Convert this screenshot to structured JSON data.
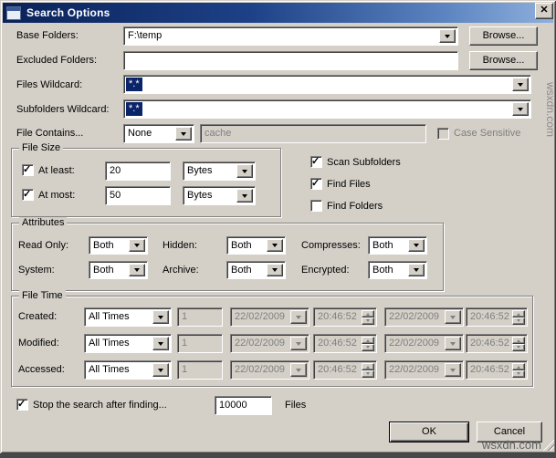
{
  "window": {
    "title": "Search Options",
    "close_glyph": "✕"
  },
  "rows": {
    "base_folders": {
      "label": "Base Folders:",
      "value": "F:\\temp",
      "browse": "Browse..."
    },
    "excluded_folders": {
      "label": "Excluded Folders:",
      "value": "",
      "browse": "Browse..."
    },
    "files_wildcard": {
      "label": "Files Wildcard:",
      "value": "*.*"
    },
    "subfolders_wildcard": {
      "label": "Subfolders Wildcard:",
      "value": "*.*"
    },
    "file_contains": {
      "label": "File Contains...",
      "mode": "None",
      "text": "cache",
      "case_label": "Case Sensitive",
      "case_checked": false,
      "case_enabled": false
    }
  },
  "file_size": {
    "title": "File Size",
    "rows": [
      {
        "label": "At least:",
        "checked": true,
        "value": "20",
        "unit": "Bytes"
      },
      {
        "label": "At most:",
        "checked": true,
        "value": "50",
        "unit": "Bytes"
      }
    ]
  },
  "options": [
    {
      "label": "Scan Subfolders",
      "checked": true
    },
    {
      "label": "Find Files",
      "checked": true
    },
    {
      "label": "Find Folders",
      "checked": false
    }
  ],
  "attributes": {
    "title": "Attributes",
    "items": [
      {
        "label": "Read Only:",
        "value": "Both"
      },
      {
        "label": "Hidden:",
        "value": "Both"
      },
      {
        "label": "Compresses:",
        "value": "Both"
      },
      {
        "label": "System:",
        "value": "Both"
      },
      {
        "label": "Archive:",
        "value": "Both"
      },
      {
        "label": "Encrypted:",
        "value": "Both"
      }
    ]
  },
  "file_time": {
    "title": "File Time",
    "rows": [
      {
        "label": "Created:",
        "mode": "All Times",
        "count": "1",
        "date1": "22/02/2009",
        "time1": "20:46:52",
        "date2": "22/02/2009",
        "time2": "20:46:52"
      },
      {
        "label": "Modified:",
        "mode": "All Times",
        "count": "1",
        "date1": "22/02/2009",
        "time1": "20:46:52",
        "date2": "22/02/2009",
        "time2": "20:46:52"
      },
      {
        "label": "Accessed:",
        "mode": "All Times",
        "count": "1",
        "date1": "22/02/2009",
        "time1": "20:46:52",
        "date2": "22/02/2009",
        "time2": "20:46:52"
      }
    ]
  },
  "footer": {
    "stop_label": "Stop the search after finding...",
    "stop_checked": true,
    "stop_value": "10000",
    "files_label": "Files",
    "ok_label": "OK",
    "cancel_label": "Cancel"
  },
  "watermark": {
    "text": "wsxdn.com"
  }
}
